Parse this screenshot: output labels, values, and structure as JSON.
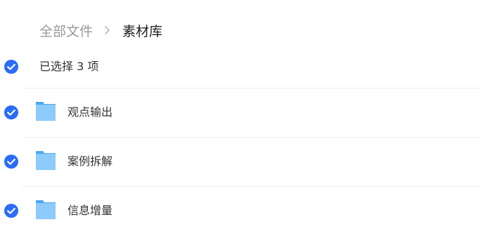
{
  "breadcrumb": {
    "root": "全部文件",
    "current": "素材库",
    "separator_icon": "chevron-right-icon"
  },
  "selection": {
    "label": "已选择 3 项",
    "checked": true
  },
  "files": [
    {
      "name": "观点输出",
      "type": "folder",
      "checked": true
    },
    {
      "name": "案例拆解",
      "type": "folder",
      "checked": true
    },
    {
      "name": "信息增量",
      "type": "folder",
      "checked": true
    }
  ],
  "colors": {
    "check": "#2a6cf6",
    "folder_front": "#8ccbfa",
    "folder_tab": "#4aa8ef",
    "divider": "#eeeeee",
    "muted_text": "#999999"
  }
}
